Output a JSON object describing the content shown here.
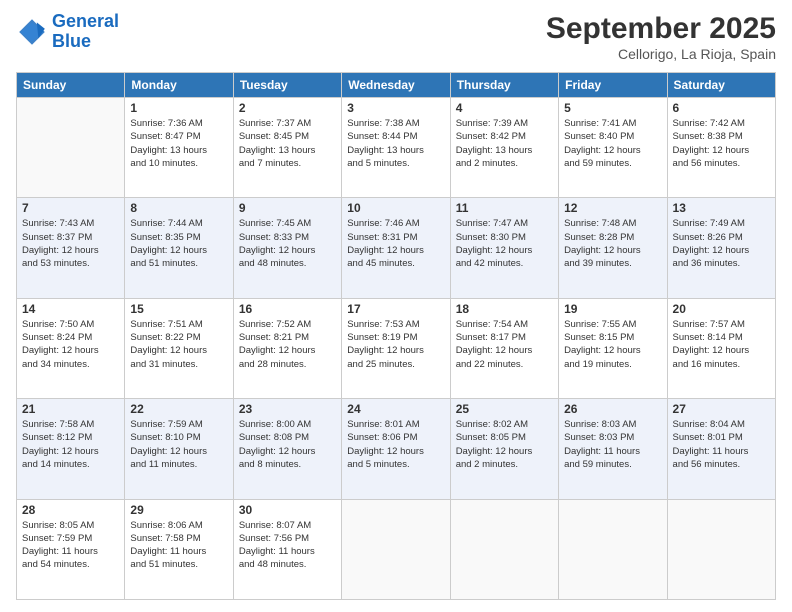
{
  "header": {
    "logo_line1": "General",
    "logo_line2": "Blue",
    "month": "September 2025",
    "location": "Cellorigo, La Rioja, Spain"
  },
  "weekdays": [
    "Sunday",
    "Monday",
    "Tuesday",
    "Wednesday",
    "Thursday",
    "Friday",
    "Saturday"
  ],
  "weeks": [
    [
      {
        "day": "",
        "info": ""
      },
      {
        "day": "1",
        "info": "Sunrise: 7:36 AM\nSunset: 8:47 PM\nDaylight: 13 hours\nand 10 minutes."
      },
      {
        "day": "2",
        "info": "Sunrise: 7:37 AM\nSunset: 8:45 PM\nDaylight: 13 hours\nand 7 minutes."
      },
      {
        "day": "3",
        "info": "Sunrise: 7:38 AM\nSunset: 8:44 PM\nDaylight: 13 hours\nand 5 minutes."
      },
      {
        "day": "4",
        "info": "Sunrise: 7:39 AM\nSunset: 8:42 PM\nDaylight: 13 hours\nand 2 minutes."
      },
      {
        "day": "5",
        "info": "Sunrise: 7:41 AM\nSunset: 8:40 PM\nDaylight: 12 hours\nand 59 minutes."
      },
      {
        "day": "6",
        "info": "Sunrise: 7:42 AM\nSunset: 8:38 PM\nDaylight: 12 hours\nand 56 minutes."
      }
    ],
    [
      {
        "day": "7",
        "info": "Sunrise: 7:43 AM\nSunset: 8:37 PM\nDaylight: 12 hours\nand 53 minutes."
      },
      {
        "day": "8",
        "info": "Sunrise: 7:44 AM\nSunset: 8:35 PM\nDaylight: 12 hours\nand 51 minutes."
      },
      {
        "day": "9",
        "info": "Sunrise: 7:45 AM\nSunset: 8:33 PM\nDaylight: 12 hours\nand 48 minutes."
      },
      {
        "day": "10",
        "info": "Sunrise: 7:46 AM\nSunset: 8:31 PM\nDaylight: 12 hours\nand 45 minutes."
      },
      {
        "day": "11",
        "info": "Sunrise: 7:47 AM\nSunset: 8:30 PM\nDaylight: 12 hours\nand 42 minutes."
      },
      {
        "day": "12",
        "info": "Sunrise: 7:48 AM\nSunset: 8:28 PM\nDaylight: 12 hours\nand 39 minutes."
      },
      {
        "day": "13",
        "info": "Sunrise: 7:49 AM\nSunset: 8:26 PM\nDaylight: 12 hours\nand 36 minutes."
      }
    ],
    [
      {
        "day": "14",
        "info": "Sunrise: 7:50 AM\nSunset: 8:24 PM\nDaylight: 12 hours\nand 34 minutes."
      },
      {
        "day": "15",
        "info": "Sunrise: 7:51 AM\nSunset: 8:22 PM\nDaylight: 12 hours\nand 31 minutes."
      },
      {
        "day": "16",
        "info": "Sunrise: 7:52 AM\nSunset: 8:21 PM\nDaylight: 12 hours\nand 28 minutes."
      },
      {
        "day": "17",
        "info": "Sunrise: 7:53 AM\nSunset: 8:19 PM\nDaylight: 12 hours\nand 25 minutes."
      },
      {
        "day": "18",
        "info": "Sunrise: 7:54 AM\nSunset: 8:17 PM\nDaylight: 12 hours\nand 22 minutes."
      },
      {
        "day": "19",
        "info": "Sunrise: 7:55 AM\nSunset: 8:15 PM\nDaylight: 12 hours\nand 19 minutes."
      },
      {
        "day": "20",
        "info": "Sunrise: 7:57 AM\nSunset: 8:14 PM\nDaylight: 12 hours\nand 16 minutes."
      }
    ],
    [
      {
        "day": "21",
        "info": "Sunrise: 7:58 AM\nSunset: 8:12 PM\nDaylight: 12 hours\nand 14 minutes."
      },
      {
        "day": "22",
        "info": "Sunrise: 7:59 AM\nSunset: 8:10 PM\nDaylight: 12 hours\nand 11 minutes."
      },
      {
        "day": "23",
        "info": "Sunrise: 8:00 AM\nSunset: 8:08 PM\nDaylight: 12 hours\nand 8 minutes."
      },
      {
        "day": "24",
        "info": "Sunrise: 8:01 AM\nSunset: 8:06 PM\nDaylight: 12 hours\nand 5 minutes."
      },
      {
        "day": "25",
        "info": "Sunrise: 8:02 AM\nSunset: 8:05 PM\nDaylight: 12 hours\nand 2 minutes."
      },
      {
        "day": "26",
        "info": "Sunrise: 8:03 AM\nSunset: 8:03 PM\nDaylight: 11 hours\nand 59 minutes."
      },
      {
        "day": "27",
        "info": "Sunrise: 8:04 AM\nSunset: 8:01 PM\nDaylight: 11 hours\nand 56 minutes."
      }
    ],
    [
      {
        "day": "28",
        "info": "Sunrise: 8:05 AM\nSunset: 7:59 PM\nDaylight: 11 hours\nand 54 minutes."
      },
      {
        "day": "29",
        "info": "Sunrise: 8:06 AM\nSunset: 7:58 PM\nDaylight: 11 hours\nand 51 minutes."
      },
      {
        "day": "30",
        "info": "Sunrise: 8:07 AM\nSunset: 7:56 PM\nDaylight: 11 hours\nand 48 minutes."
      },
      {
        "day": "",
        "info": ""
      },
      {
        "day": "",
        "info": ""
      },
      {
        "day": "",
        "info": ""
      },
      {
        "day": "",
        "info": ""
      }
    ]
  ]
}
